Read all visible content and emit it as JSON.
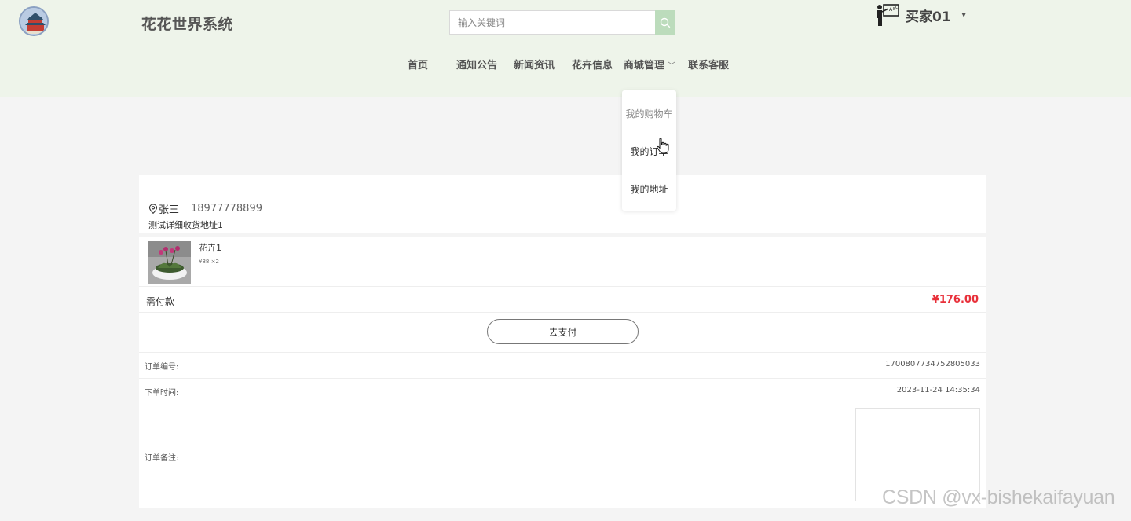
{
  "header": {
    "site_title": "花花世界系统",
    "search_placeholder": "输入关键词",
    "search_icon": "search-icon",
    "user_name": "买家01",
    "user_caret": "▾"
  },
  "nav": {
    "items": [
      {
        "label": "首页"
      },
      {
        "label": "通知公告"
      },
      {
        "label": "新闻资讯"
      },
      {
        "label": "花卉信息"
      },
      {
        "label": "商城管理",
        "has_dropdown": true
      },
      {
        "label": "联系客服"
      }
    ],
    "dropdown": [
      {
        "label": "我的购物车"
      },
      {
        "label": "我的订单"
      },
      {
        "label": "我的地址"
      }
    ]
  },
  "order": {
    "address": {
      "name": "张三",
      "phone": "18977778899",
      "detail": "测试详细收货地址1"
    },
    "product": {
      "name": "花卉1",
      "meta": "¥88 ×2"
    },
    "payable_label": "需付款",
    "payable_amount": "¥176.00",
    "pay_button": "去支付",
    "order_no_label": "订单编号:",
    "order_no": "1700807734752805033",
    "order_time_label": "下单时间:",
    "order_time": "2023-11-24 14:35:34",
    "remark_label": "订单备注:"
  },
  "watermark": "CSDN @vx-bishekaifayuan",
  "colors": {
    "header_bg": "#eef4ea",
    "search_button": "#bcdcbc",
    "price": "#e8303a"
  }
}
